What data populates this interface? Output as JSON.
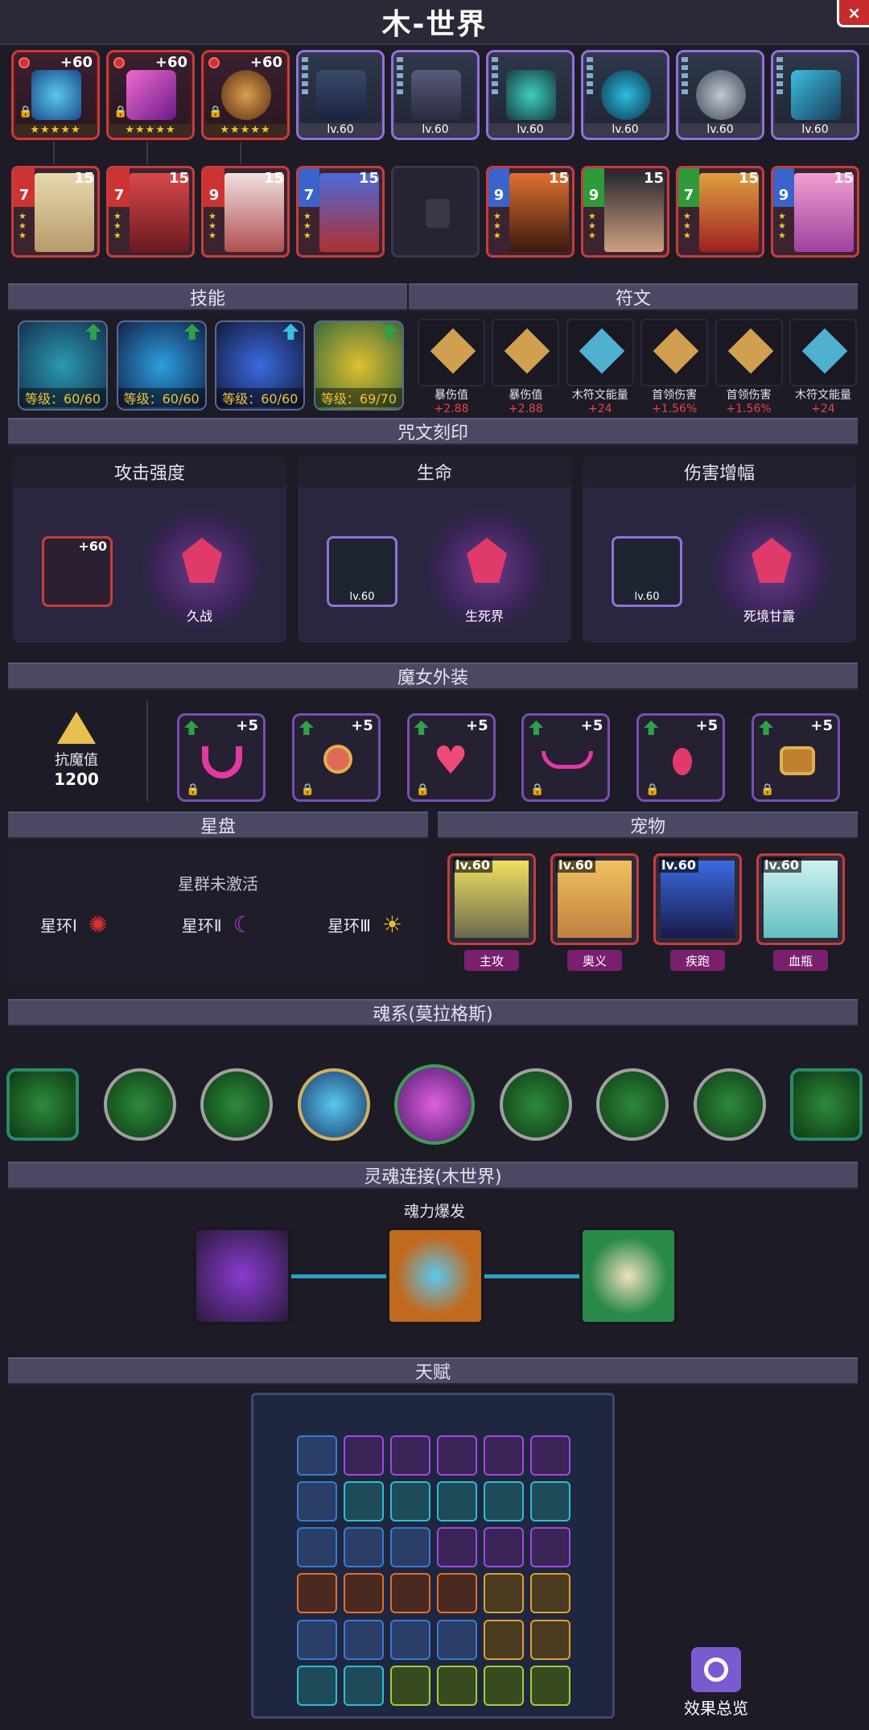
{
  "title": "木-世界",
  "close_label": "×",
  "gear": [
    {
      "plus": "+60",
      "stars": "★★★★★",
      "color": "red"
    },
    {
      "plus": "+60",
      "stars": "★★★★★",
      "color": "red"
    },
    {
      "plus": "+60",
      "stars": "★★★★★",
      "color": "red"
    },
    {
      "lv": "lv.60",
      "color": "purple"
    },
    {
      "lv": "lv.60",
      "color": "purple"
    },
    {
      "lv": "lv.60",
      "color": "purple"
    },
    {
      "lv": "lv.60",
      "color": "purple"
    },
    {
      "lv": "lv.60",
      "color": "purple"
    },
    {
      "lv": "lv.60",
      "color": "purple"
    }
  ],
  "heroes": [
    {
      "num": "7",
      "level": "15",
      "tier": "red"
    },
    {
      "num": "7",
      "level": "15",
      "tier": "red"
    },
    {
      "num": "9",
      "level": "15",
      "tier": "red"
    },
    {
      "num": "7",
      "level": "15",
      "tier": "blue"
    },
    {
      "empty": true
    },
    {
      "num": "9",
      "level": "15",
      "tier": "blue"
    },
    {
      "num": "9",
      "level": "15",
      "tier": "green"
    },
    {
      "num": "7",
      "level": "15",
      "tier": "green"
    },
    {
      "num": "9",
      "level": "15",
      "tier": "blue"
    }
  ],
  "sections": {
    "skills": "技能",
    "runes": "符文",
    "curse": "咒文刻印",
    "outfit": "魔女外装",
    "starplate": "星盘",
    "pets": "宠物",
    "soul": "魂系(莫拉格斯)",
    "soul_link": "灵魂连接(木世界)",
    "talent": "天赋"
  },
  "skills": [
    {
      "level": "等级：60/60"
    },
    {
      "level": "等级：60/60"
    },
    {
      "level": "等级：60/60"
    },
    {
      "level": "等级：69/70"
    }
  ],
  "runes": [
    {
      "name": "暴伤值",
      "value": "+2.88"
    },
    {
      "name": "暴伤值",
      "value": "+2.88"
    },
    {
      "name": "木符文能量",
      "value": "+24"
    },
    {
      "name": "首领伤害",
      "value": "+1.56%"
    },
    {
      "name": "首领伤害",
      "value": "+1.56%"
    },
    {
      "name": "木符文能量",
      "value": "+24"
    }
  ],
  "curse": [
    {
      "label": "攻击强度",
      "item": "+60",
      "name": "久战"
    },
    {
      "label": "生命",
      "item": "lv.60",
      "name": "生死界"
    },
    {
      "label": "伤害增幅",
      "item": "lv.60",
      "name": "死境甘露"
    }
  ],
  "outfit": {
    "resist_label": "抗魔值",
    "resist_value": "1200",
    "items": [
      "+5",
      "+5",
      "+5",
      "+5",
      "+5",
      "+5"
    ]
  },
  "starplate": {
    "status": "星群未激活",
    "rings": [
      "星环Ⅰ",
      "星环Ⅱ",
      "星环Ⅲ"
    ]
  },
  "pets": [
    {
      "lv": "lv.60",
      "tag": "主攻"
    },
    {
      "lv": "lv.60",
      "tag": "奥义"
    },
    {
      "lv": "lv.60",
      "tag": "疾跑"
    },
    {
      "lv": "lv.60",
      "tag": "血瓶"
    }
  ],
  "soul_link": {
    "caption": "魂力爆发"
  },
  "effects_overview": "效果总览",
  "colors": {
    "accent_red": "#c83c3c",
    "accent_purple": "#8f73d6",
    "gold": "#f2c23a",
    "green": "#2fa04b"
  }
}
